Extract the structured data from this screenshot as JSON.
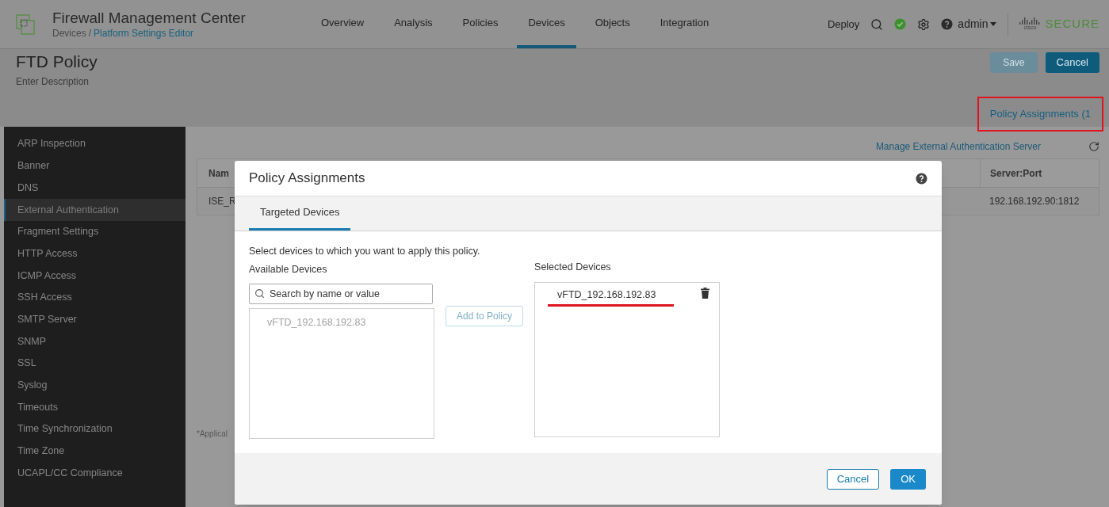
{
  "header": {
    "app_title": "Firewall Management Center",
    "breadcrumb": [
      {
        "label": "Devices",
        "link": false
      },
      {
        "label": "/",
        "link": false
      },
      {
        "label": "Platform Settings Editor",
        "link": true
      }
    ],
    "nav": [
      {
        "label": "Overview",
        "selected": false
      },
      {
        "label": "Analysis",
        "selected": false
      },
      {
        "label": "Policies",
        "selected": false
      },
      {
        "label": "Devices",
        "selected": true
      },
      {
        "label": "Objects",
        "selected": false
      },
      {
        "label": "Integration",
        "selected": false
      }
    ],
    "deploy": "Deploy",
    "user": "admin",
    "brand": {
      "mark": "cisco",
      "name": "SECURE"
    }
  },
  "policy": {
    "title": "FTD Policy",
    "description": "Enter Description",
    "save": {
      "label": "Save",
      "disabled": true
    },
    "cancel": "Cancel",
    "assignments_link": "Policy Assignments (1"
  },
  "sidebar": {
    "items": [
      {
        "label": "ARP Inspection",
        "selected": false
      },
      {
        "label": "Banner",
        "selected": false
      },
      {
        "label": "DNS",
        "selected": false
      },
      {
        "label": "External Authentication",
        "selected": true
      },
      {
        "label": "Fragment Settings",
        "selected": false
      },
      {
        "label": "HTTP Access",
        "selected": false
      },
      {
        "label": "ICMP Access",
        "selected": false
      },
      {
        "label": "SSH Access",
        "selected": false
      },
      {
        "label": "SMTP Server",
        "selected": false
      },
      {
        "label": "SNMP",
        "selected": false
      },
      {
        "label": "SSL",
        "selected": false
      },
      {
        "label": "Syslog",
        "selected": false
      },
      {
        "label": "Timeouts",
        "selected": false
      },
      {
        "label": "Time Synchronization",
        "selected": false
      },
      {
        "label": "Time Zone",
        "selected": false
      },
      {
        "label": "UCAPL/CC Compliance",
        "selected": false
      }
    ]
  },
  "content": {
    "manage_link": "Manage External Authentication Server",
    "table": {
      "columns": [
        "Nam",
        "Server:Port"
      ],
      "rows": [
        [
          "ISE_R",
          "192.168.192.90:1812"
        ]
      ]
    },
    "footnote": "*Applical"
  },
  "dialog": {
    "title": "Policy Assignments",
    "tabs": [
      {
        "label": "Targeted Devices",
        "selected": true
      }
    ],
    "instruction": "Select devices to which you want to apply this policy.",
    "available": {
      "label": "Available Devices",
      "search_placeholder": "Search by name or value",
      "items": [
        {
          "name": "vFTD_192.168.192.83",
          "disabled": true
        }
      ]
    },
    "add_button": {
      "label": "Add to Policy",
      "disabled": true
    },
    "selected": {
      "label": "Selected Devices",
      "items": [
        {
          "name": "vFTD_192.168.192.83"
        }
      ]
    },
    "buttons": {
      "cancel": "Cancel",
      "ok": "OK"
    }
  }
}
